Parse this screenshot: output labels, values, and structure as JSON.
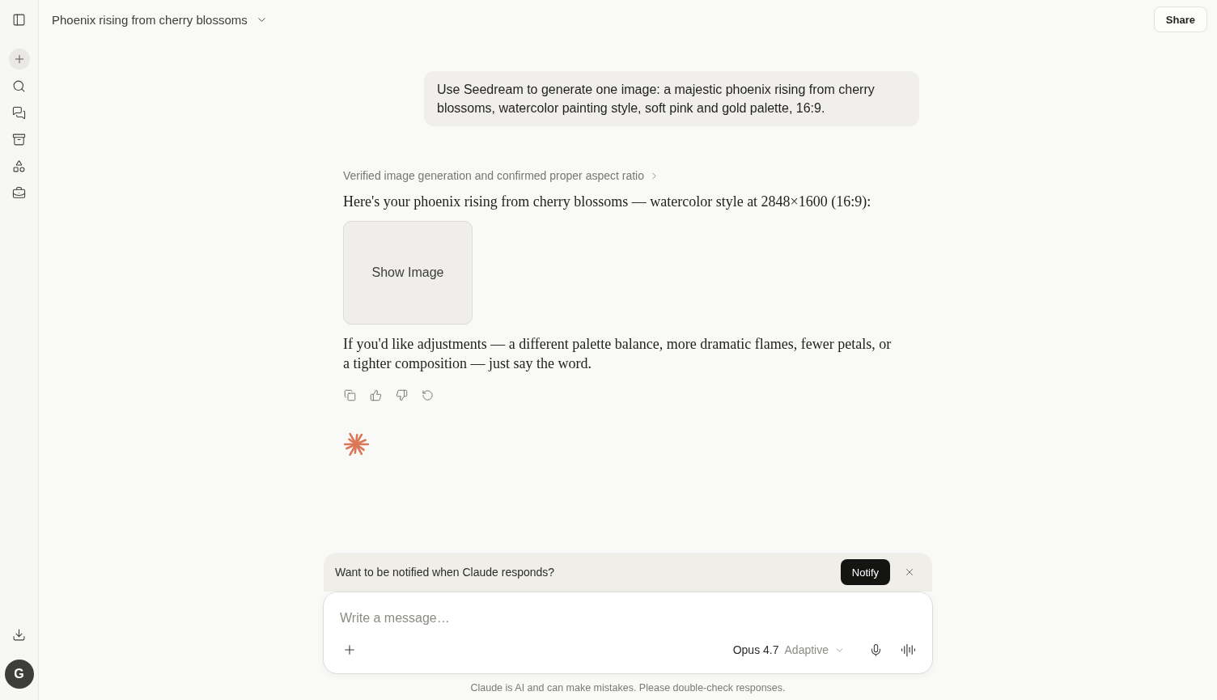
{
  "sidebar": {
    "user_initial": "G"
  },
  "header": {
    "title": "Phoenix rising from cherry blossoms",
    "share_button": "Share"
  },
  "messages": [
    {
      "kind": "user",
      "text": "Use Seedream to generate one image: a majestic phoenix rising from cherry blossoms, watercolor painting style, soft pink and gold palette, 16:9."
    },
    {
      "kind": "assistant",
      "thinking": {
        "summary": "Verified image generation and confirmed proper aspect ratio",
        "expanded": false
      },
      "blocks": [
        {
          "kind": "text",
          "text": "Here's your phoenix rising from cherry blossoms — watercolor style at 2848×1600 (16:9):"
        },
        {
          "kind": "image_button",
          "label": "Show Image"
        },
        {
          "kind": "text",
          "text": "If you'd like adjustments — a different palette balance, more dramatic flames, fewer petals, or a tighter composition — just say the word."
        }
      ]
    }
  ],
  "notification": {
    "text": "Want to be notified when Claude responds?",
    "button": "Notify"
  },
  "composer": {
    "placeholder": "Write a message…",
    "model": "Opus 4.7",
    "mode": "Adaptive"
  },
  "disclaimer": "Claude is AI and can make mistakes. Please double-check responses."
}
